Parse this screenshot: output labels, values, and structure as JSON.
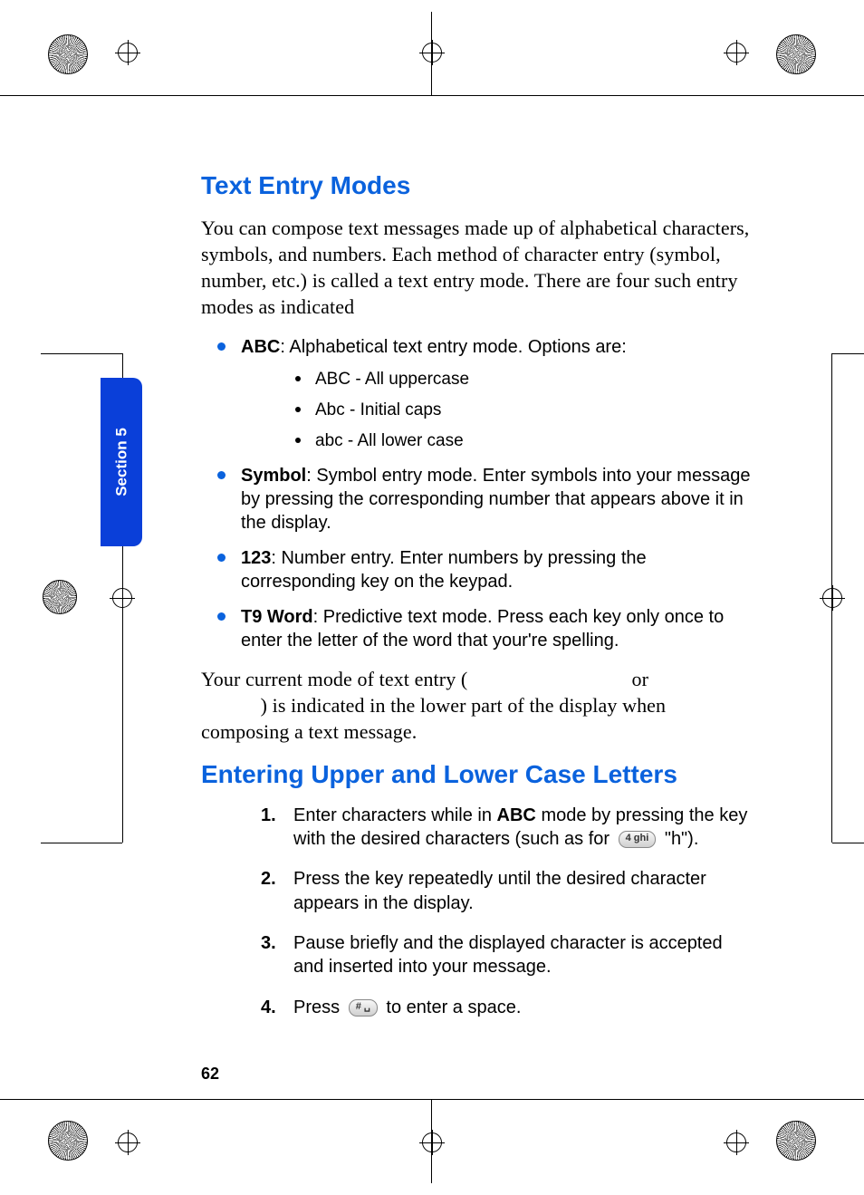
{
  "section_tab": "Section 5",
  "page_number": "62",
  "heading1": "Text Entry Modes",
  "intro": "You can compose text messages made up of alphabetical characters, symbols, and numbers. Each method of character entry (symbol, number, etc.) is called a text entry mode. There are four such entry modes as indicated",
  "modes": {
    "abc": {
      "label": "ABC",
      "text": ": Alphabetical text entry mode. Options are:",
      "sub": [
        "ABC - All uppercase",
        "Abc - Initial caps",
        "abc - All lower case"
      ]
    },
    "symbol": {
      "label": "Symbol",
      "text": ": Symbol entry mode. Enter symbols into your message by pressing the corresponding number that appears above it in the display."
    },
    "num": {
      "label": "123",
      "text": ": Number entry. Enter numbers by pressing the corresponding key on the keypad."
    },
    "t9": {
      "label": "T9 Word",
      "text": ": Predictive text mode. Press each key only once to enter the letter of the word that your're spelling."
    }
  },
  "mode_indicator": {
    "pre": "Your current mode of text entry (",
    "mid": " or ",
    "post": ") is indicated in the lower part of the display when composing a text message."
  },
  "heading2": "Entering Upper and Lower Case Letters",
  "steps": {
    "s1a": "Enter characters while in ",
    "s1_bold": "ABC",
    "s1b": " mode by pressing the key with the desired characters (such as for ",
    "s1c": " \"h\").",
    "s2": "Press the key repeatedly until the desired character appears in the display.",
    "s3": "Pause briefly and the displayed character is accepted and inserted into your message.",
    "s4a": "Press ",
    "s4b": " to enter a space."
  },
  "keys": {
    "four": "4 ghi",
    "hash": "# ␣"
  }
}
